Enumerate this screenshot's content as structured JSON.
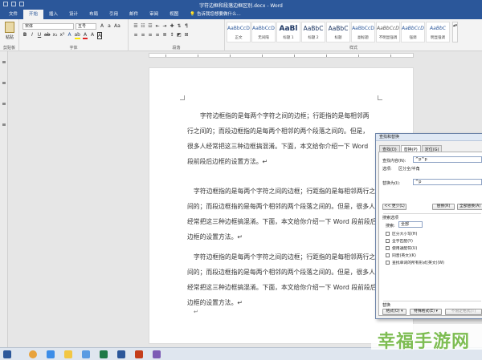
{
  "titlebar": {
    "title": "字符边框和段落边框区别.docx - Word"
  },
  "tabs": [
    {
      "label": "文件"
    },
    {
      "label": "开始"
    },
    {
      "label": "插入"
    },
    {
      "label": "设计"
    },
    {
      "label": "布局"
    },
    {
      "label": "引用"
    },
    {
      "label": "邮件"
    },
    {
      "label": "审阅"
    },
    {
      "label": "视图"
    },
    {
      "label": "告诉我您想要做什么..."
    }
  ],
  "ribbon": {
    "clipboard": {
      "paste_label": "粘贴",
      "group_label": "剪贴板"
    },
    "font": {
      "name_value": "宋体",
      "size_value": "五号",
      "group_label": "字体"
    },
    "paragraph": {
      "group_label": "段落"
    },
    "styles": {
      "group_label": "样式",
      "items": [
        {
          "sample": "AaBbCcDc",
          "name": "正文"
        },
        {
          "sample": "AaBbCcDc",
          "name": "无间隔"
        },
        {
          "sample": "AaBl",
          "name": "标题 1"
        },
        {
          "sample": "AaBbC",
          "name": "标题 2"
        },
        {
          "sample": "AaBbC",
          "name": "标题"
        },
        {
          "sample": "AaBbCcD",
          "name": "副标题"
        },
        {
          "sample": "AaBbCcDc",
          "name": "不明显强调"
        },
        {
          "sample": "AaBbCcDc",
          "name": "强调"
        },
        {
          "sample": "AaBbC",
          "name": "明显强调"
        }
      ]
    }
  },
  "document": {
    "paragraphs": [
      {
        "lines": [
          "字符边框指的是每两个字符之间的边框；行距指的是每相邻两",
          "行之间的；而段边框指的是每两个相邻的两个段落之间的。但是，",
          "很多人经常把这三种边框搞混淆。下面，本文给你介绍一下 Word",
          "段前段后边框的设置方法。↵"
        ]
      },
      {
        "lines": [
          "字符边框指的是每两个字符之间的边框；行距指的是每相邻两行之",
          "间的；而段边框指的是每两个相邻的两个段落之间的。但是，很多人",
          "经常把这三种边框搞混淆。下面，本文给你介绍一下 Word 段前段后",
          "边框的设置方法。↵"
        ]
      },
      {
        "lines": [
          "字符边框指的是每两个字符之间的边框；行距指的是每相邻两行之",
          "间的；而段边框指的是每两个相邻的两个段落之间的。但是，很多人",
          "经常把这三种边框搞混淆。下面，本文给你介绍一下 Word 段前段后",
          "边框的设置方法。↵"
        ]
      }
    ],
    "end_mark": "↵"
  },
  "dialog": {
    "title": "查找和替换",
    "tabs": [
      "查找(D)",
      "替换(P)",
      "定位(G)"
    ],
    "find_label": "查找内容(N):",
    "find_value": "^p^p",
    "options_label": "选项:",
    "options_value": "区分全/半角",
    "replace_label": "替换为(I):",
    "replace_value": "^p",
    "less_button": "<< 更少(L)",
    "replace_button": "替换(R)",
    "replace_all_button": "全部替换(A)",
    "search_options_label": "搜索选项",
    "search_label": "搜索:",
    "search_value": "全部",
    "checks": [
      {
        "label": "区分大小写(H)",
        "checked": false
      },
      {
        "label": "全字匹配(Y)",
        "checked": false
      },
      {
        "label": "使用通配符(U)",
        "checked": false
      },
      {
        "label": "同音(英文)(K)",
        "checked": false
      },
      {
        "label": "查找单词的所有形式(英文)(W)",
        "checked": false
      }
    ],
    "replace_section_label": "替换",
    "format_button": "格式(O) ▾",
    "special_button": "特殊格式(E) ▾",
    "noformat_button": "不限定格式(T)"
  },
  "watermark": {
    "text": "幸福手游网"
  },
  "colors": {
    "word_blue": "#2b579a",
    "watermark_green": "#7ebd53"
  }
}
